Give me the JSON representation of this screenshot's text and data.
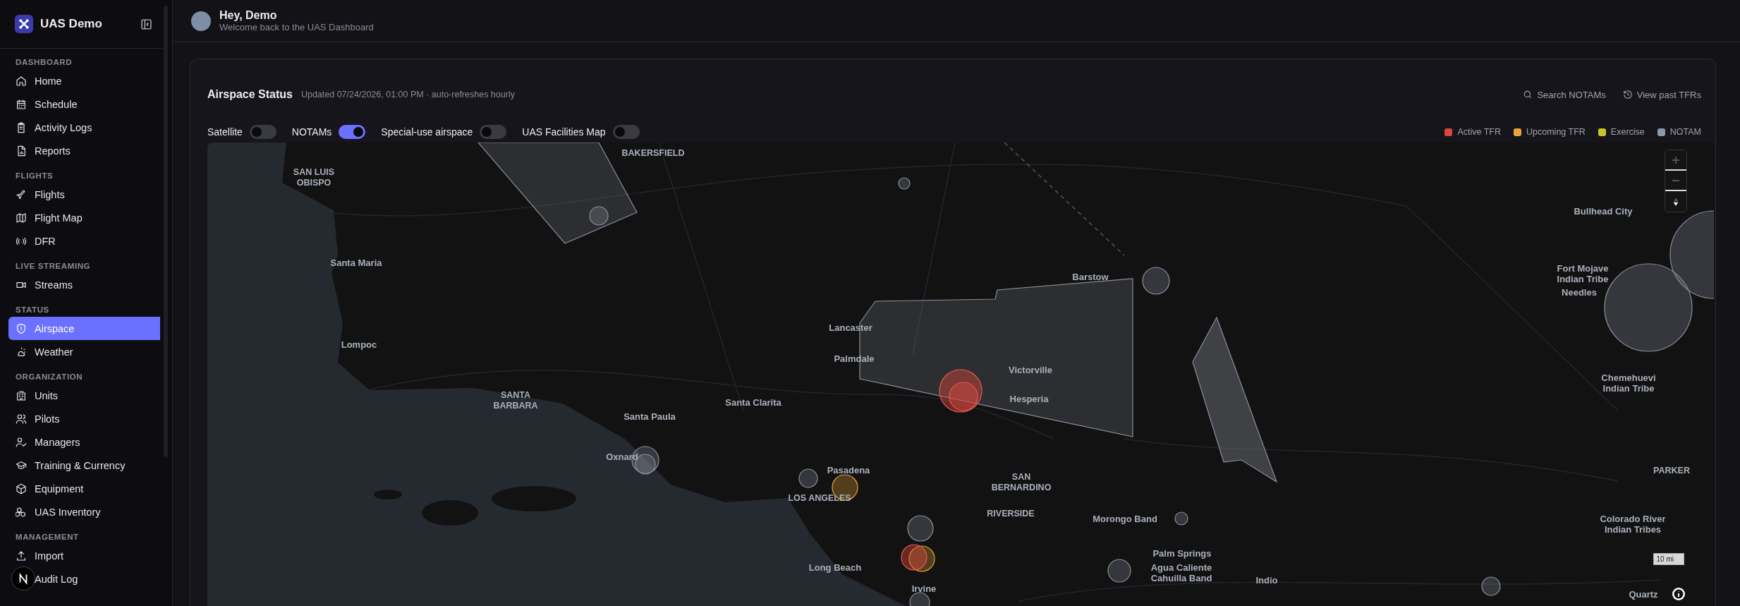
{
  "sidebar": {
    "brand": "UAS Demo",
    "sections": [
      {
        "heading": "DASHBOARD",
        "items": [
          {
            "label": "Home",
            "selected": false
          },
          {
            "label": "Schedule",
            "selected": false
          },
          {
            "label": "Activity Logs",
            "selected": false
          },
          {
            "label": "Reports",
            "selected": false
          }
        ]
      },
      {
        "heading": "FLIGHTS",
        "items": [
          {
            "label": "Flights",
            "selected": false
          },
          {
            "label": "Flight Map",
            "selected": false
          },
          {
            "label": "DFR",
            "selected": false
          }
        ]
      },
      {
        "heading": "LIVE STREAMING",
        "items": [
          {
            "label": "Streams",
            "selected": false
          }
        ]
      },
      {
        "heading": "STATUS",
        "items": [
          {
            "label": "Airspace",
            "selected": true
          },
          {
            "label": "Weather",
            "selected": false
          }
        ]
      },
      {
        "heading": "ORGANIZATION",
        "items": [
          {
            "label": "Units",
            "selected": false
          },
          {
            "label": "Pilots",
            "selected": false
          },
          {
            "label": "Managers",
            "selected": false
          },
          {
            "label": "Training & Currency",
            "selected": false
          },
          {
            "label": "Equipment",
            "selected": false
          },
          {
            "label": "UAS Inventory",
            "selected": false
          }
        ]
      },
      {
        "heading": "MANAGEMENT",
        "items": [
          {
            "label": "Import",
            "selected": false
          },
          {
            "label": "Audit Log",
            "selected": false
          }
        ]
      }
    ]
  },
  "header": {
    "greeting": "Hey, Demo",
    "subtitle": "Welcome back to the UAS Dashboard"
  },
  "airspace": {
    "title": "Airspace Status",
    "updated": "Updated 07/24/2026, 01:00 PM · auto-refreshes hourly",
    "actions": [
      "Search NOTAMs",
      "View past TFRs"
    ],
    "layers": [
      {
        "label": "Satellite",
        "on": false
      },
      {
        "label": "NOTAMs",
        "on": true
      },
      {
        "label": "Special-use airspace",
        "on": false
      },
      {
        "label": "UAS Facilities Map",
        "on": false
      }
    ],
    "legend": [
      {
        "label": "Active TFR",
        "color": "#d9473f"
      },
      {
        "label": "Upcoming TFR",
        "color": "#e8a436"
      },
      {
        "label": "Exercise",
        "color": "#c9c228"
      },
      {
        "label": "NOTAM",
        "color": "#8f98a8"
      }
    ],
    "map": {
      "scale": "10 mi",
      "places": [
        {
          "lines": [
            "BAKERSFIELD"
          ]
        },
        {
          "lines": [
            "SAN LUIS",
            "OBISPO"
          ]
        },
        {
          "lines": [
            "Santa Maria"
          ]
        },
        {
          "lines": [
            "Lompoc"
          ]
        },
        {
          "lines": [
            "SANTA",
            "BARBARA"
          ]
        },
        {
          "lines": [
            "Santa Paula"
          ]
        },
        {
          "lines": [
            "Santa Clarita"
          ]
        },
        {
          "lines": [
            "Oxnard"
          ]
        },
        {
          "lines": [
            "Lancaster"
          ]
        },
        {
          "lines": [
            "Palmdale"
          ]
        },
        {
          "lines": [
            "Barstow"
          ]
        },
        {
          "lines": [
            "Victorville"
          ]
        },
        {
          "lines": [
            "Hesperia"
          ]
        },
        {
          "lines": [
            "Pasadena"
          ]
        },
        {
          "lines": [
            "LOS ANGELES"
          ]
        },
        {
          "lines": [
            "SAN",
            "BERNARDINO"
          ]
        },
        {
          "lines": [
            "RIVERSIDE"
          ]
        },
        {
          "lines": [
            "Morongo Band"
          ]
        },
        {
          "lines": [
            "Palm Springs"
          ]
        },
        {
          "lines": [
            "Agua Caliente",
            "Cahuilla Band"
          ]
        },
        {
          "lines": [
            "Indio"
          ]
        },
        {
          "lines": [
            "Long Beach"
          ]
        },
        {
          "lines": [
            "Irvine"
          ]
        },
        {
          "lines": [
            "Bullhead City"
          ]
        },
        {
          "lines": [
            "Fort Mojave",
            "Indian Tribe"
          ]
        },
        {
          "lines": [
            "Needles"
          ]
        },
        {
          "lines": [
            "Chemehuevi",
            "Indian Tribe"
          ]
        },
        {
          "lines": [
            "PARKER"
          ]
        },
        {
          "lines": [
            "Colorado River",
            "Indian Tribes"
          ]
        },
        {
          "lines": [
            "Quartz"
          ]
        }
      ]
    }
  }
}
